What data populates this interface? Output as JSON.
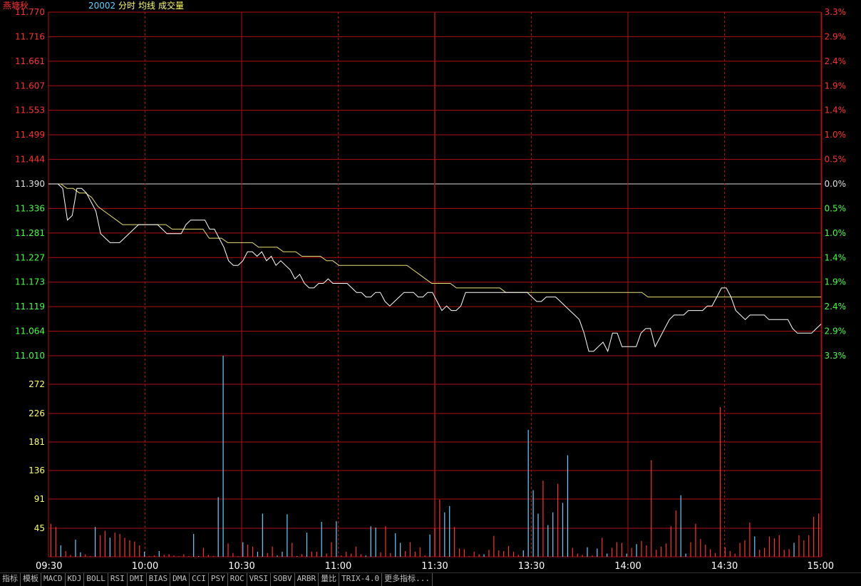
{
  "header": {
    "stock_name": "燕塘秋",
    "code": "20002",
    "mode": "分时",
    "avg_label": "均线",
    "vol_label": "成交量",
    "name_color": "#ff3333",
    "code_color": "#5fd3ff",
    "label_color": "#ffff66"
  },
  "colors": {
    "grid": "#b01010",
    "up": "#ff3030",
    "down": "#40ff40",
    "flat": "#e0e0e0",
    "price_line": "#ffffff",
    "avg_line": "#e8e070",
    "vol_up": "#ff3030",
    "vol_down": "#5fd3ff",
    "vol_label": "#ffff66",
    "time_label": "#ffffff"
  },
  "tabs": [
    "指标",
    "模板",
    "MACD",
    "KDJ",
    "BOLL",
    "RSI",
    "DMI",
    "BIAS",
    "DMA",
    "CCI",
    "PSY",
    "ROC",
    "VRSI",
    "SOBV",
    "ARBR",
    "量比",
    "TRIX-4.0",
    "更多指标..."
  ],
  "chart_data": {
    "type": "line",
    "x": [
      "09:30",
      "10:00",
      "10:30",
      "11:00",
      "11:30",
      "13:30",
      "14:00",
      "14:30",
      "15:00"
    ],
    "price_ticks": [
      "11.770",
      "11.716",
      "11.661",
      "11.607",
      "11.553",
      "11.499",
      "11.444",
      "11.390",
      "11.336",
      "11.281",
      "11.227",
      "11.173",
      "11.119",
      "11.064",
      "11.010"
    ],
    "pct_ticks": [
      "3.3%",
      "2.9%",
      "2.4%",
      "1.9%",
      "1.4%",
      "1.0%",
      "0.5%",
      "0.0%",
      "0.5%",
      "1.0%",
      "1.4%",
      "1.9%",
      "2.4%",
      "2.9%",
      "3.3%"
    ],
    "prev_close": 11.39,
    "ylim": [
      11.01,
      11.77
    ],
    "volume_ticks": [
      "272",
      "226",
      "181",
      "136",
      "91",
      "45"
    ],
    "volume_max": 317,
    "series": [
      {
        "values": [
          11.39,
          11.39,
          11.39,
          11.38,
          11.31,
          11.32,
          11.38,
          11.38,
          11.37,
          11.35,
          11.33,
          11.28,
          11.27,
          11.26,
          11.26,
          11.26,
          11.27,
          11.28,
          11.29,
          11.3,
          11.3,
          11.3,
          11.3,
          11.3,
          11.29,
          11.28,
          11.28,
          11.28,
          11.28,
          11.3,
          11.31,
          11.31,
          11.31,
          11.31,
          11.29,
          11.29,
          11.27,
          11.25,
          11.22,
          11.21,
          11.21,
          11.22,
          11.24,
          11.24,
          11.23,
          11.24,
          11.22,
          11.23,
          11.21,
          11.22,
          11.21,
          11.2,
          11.18,
          11.19,
          11.17,
          11.16,
          11.16,
          11.17,
          11.17,
          11.18,
          11.17,
          11.17,
          11.17,
          11.17,
          11.16,
          11.15,
          11.15,
          11.14,
          11.14,
          11.15,
          11.15,
          11.13,
          11.12,
          11.13,
          11.14,
          11.15,
          11.15,
          11.15,
          11.14,
          11.14,
          11.15,
          11.15,
          11.13,
          11.11,
          11.12,
          11.11,
          11.11,
          11.12,
          11.15,
          11.15,
          11.15,
          11.15,
          11.15,
          11.15,
          11.15,
          11.15,
          11.15,
          11.15,
          11.15,
          11.15,
          11.15,
          11.15,
          11.14,
          11.13,
          11.13,
          11.14,
          11.14,
          11.14,
          11.13,
          11.12,
          11.11,
          11.1,
          11.09,
          11.06,
          11.02,
          11.02,
          11.03,
          11.04,
          11.02,
          11.06,
          11.06,
          11.03,
          11.03,
          11.03,
          11.03,
          11.06,
          11.07,
          11.07,
          11.03,
          11.05,
          11.07,
          11.09,
          11.1,
          11.1,
          11.1,
          11.11,
          11.11,
          11.11,
          11.11,
          11.12,
          11.12,
          11.14,
          11.16,
          11.16,
          11.14,
          11.11,
          11.1,
          11.09,
          11.1,
          11.1,
          11.1,
          11.1,
          11.09,
          11.09,
          11.09,
          11.09,
          11.09,
          11.07,
          11.06,
          11.06,
          11.06,
          11.06,
          11.07,
          11.08
        ]
      },
      {
        "values": [
          11.39,
          11.39,
          11.39,
          11.38,
          11.38,
          11.37,
          11.37,
          11.36,
          11.34,
          11.33,
          11.32,
          11.31,
          11.3,
          11.3,
          11.3,
          11.3,
          11.3,
          11.3,
          11.3,
          11.3,
          11.29,
          11.29,
          11.29,
          11.29,
          11.29,
          11.29,
          11.27,
          11.27,
          11.27,
          11.26,
          11.26,
          11.26,
          11.26,
          11.26,
          11.25,
          11.25,
          11.25,
          11.25,
          11.24,
          11.24,
          11.24,
          11.23,
          11.23,
          11.23,
          11.23,
          11.22,
          11.22,
          11.21,
          11.21,
          11.21,
          11.21,
          11.21,
          11.21,
          11.21,
          11.21,
          11.21,
          11.21,
          11.21,
          11.21,
          11.2,
          11.19,
          11.18,
          11.17,
          11.17,
          11.17,
          11.17,
          11.16,
          11.16,
          11.16,
          11.16,
          11.16,
          11.16,
          11.16,
          11.16,
          11.15,
          11.15,
          11.15,
          11.15,
          11.15,
          11.15,
          11.15,
          11.15,
          11.15,
          11.15,
          11.15,
          11.15,
          11.15,
          11.15,
          11.15,
          11.15,
          11.15,
          11.15,
          11.15,
          11.15,
          11.15,
          11.15,
          11.15,
          11.14,
          11.14,
          11.14,
          11.14,
          11.14,
          11.14,
          11.14,
          11.14,
          11.14,
          11.14,
          11.14,
          11.14,
          11.14,
          11.14,
          11.14,
          11.14,
          11.14,
          11.14,
          11.14,
          11.14,
          11.14,
          11.14,
          11.14,
          11.14,
          11.14,
          11.14,
          11.14,
          11.14,
          11.14
        ]
      }
    ],
    "volume": [
      52,
      47,
      18,
      9,
      3,
      27,
      7,
      4,
      1,
      47,
      34,
      41,
      30,
      38,
      36,
      30,
      26,
      24,
      18,
      8,
      1,
      2,
      9,
      3,
      4,
      2,
      1,
      4,
      1,
      36,
      1,
      14,
      3,
      1,
      94,
      317,
      21,
      6,
      1,
      23,
      19,
      16,
      8,
      68,
      6,
      16,
      2,
      8,
      67,
      22,
      1,
      4,
      38,
      8,
      8,
      55,
      5,
      23,
      56,
      2,
      8,
      5,
      16,
      4,
      2,
      48,
      46,
      7,
      48,
      6,
      37,
      22,
      9,
      23,
      8,
      15,
      2,
      35,
      45,
      90,
      70,
      80,
      47,
      13,
      12,
      1,
      8,
      4,
      4,
      11,
      33,
      10,
      9,
      17,
      8,
      3,
      10,
      200,
      105,
      68,
      120,
      50,
      70,
      115,
      85,
      160,
      14,
      5,
      3,
      15,
      2,
      13,
      30,
      5,
      14,
      23,
      22,
      5,
      14,
      20,
      25,
      18,
      152,
      11,
      16,
      21,
      48,
      73,
      97,
      5,
      23,
      52,
      28,
      19,
      12,
      6,
      236,
      15,
      9,
      5,
      22,
      26,
      54,
      32,
      11,
      14,
      32,
      29,
      34,
      11,
      12,
      22,
      34,
      26,
      34,
      63,
      68
    ],
    "volume_dir": [
      "up",
      "up",
      "down",
      "up",
      "up",
      "down",
      "down",
      "up",
      "up",
      "down",
      "up",
      "up",
      "down",
      "up",
      "up",
      "up",
      "up",
      "up",
      "up",
      "down",
      "up",
      "up",
      "down",
      "up",
      "up",
      "up",
      "up",
      "up",
      "up",
      "down",
      "down",
      "up",
      "up",
      "up",
      "down",
      "down",
      "up",
      "up",
      "up",
      "down",
      "up",
      "up",
      "down",
      "down",
      "up",
      "up",
      "down",
      "down",
      "down",
      "up",
      "down",
      "up",
      "down",
      "up",
      "up",
      "down",
      "up",
      "up",
      "down",
      "up",
      "up",
      "up",
      "up",
      "up",
      "down",
      "down",
      "down",
      "up",
      "up",
      "up",
      "down",
      "down",
      "up",
      "up",
      "up",
      "up",
      "up",
      "down",
      "up",
      "up",
      "down",
      "down",
      "up",
      "up",
      "up",
      "up",
      "up",
      "up",
      "down",
      "up",
      "up",
      "up",
      "up",
      "up",
      "up",
      "up",
      "down",
      "down",
      "down",
      "down",
      "up",
      "down",
      "down",
      "up",
      "down",
      "down",
      "up",
      "up",
      "up",
      "down",
      "up",
      "down",
      "up",
      "down",
      "up",
      "up",
      "up",
      "down",
      "up",
      "down",
      "up",
      "up",
      "up",
      "up",
      "up",
      "up",
      "up",
      "up",
      "down",
      "down",
      "up",
      "up",
      "up",
      "up",
      "up",
      "up",
      "up",
      "up",
      "up",
      "up",
      "up",
      "up",
      "up",
      "down",
      "up",
      "up",
      "up",
      "up",
      "up",
      "up",
      "up",
      "down",
      "up",
      "up",
      "up",
      "up",
      "up",
      "down"
    ]
  }
}
